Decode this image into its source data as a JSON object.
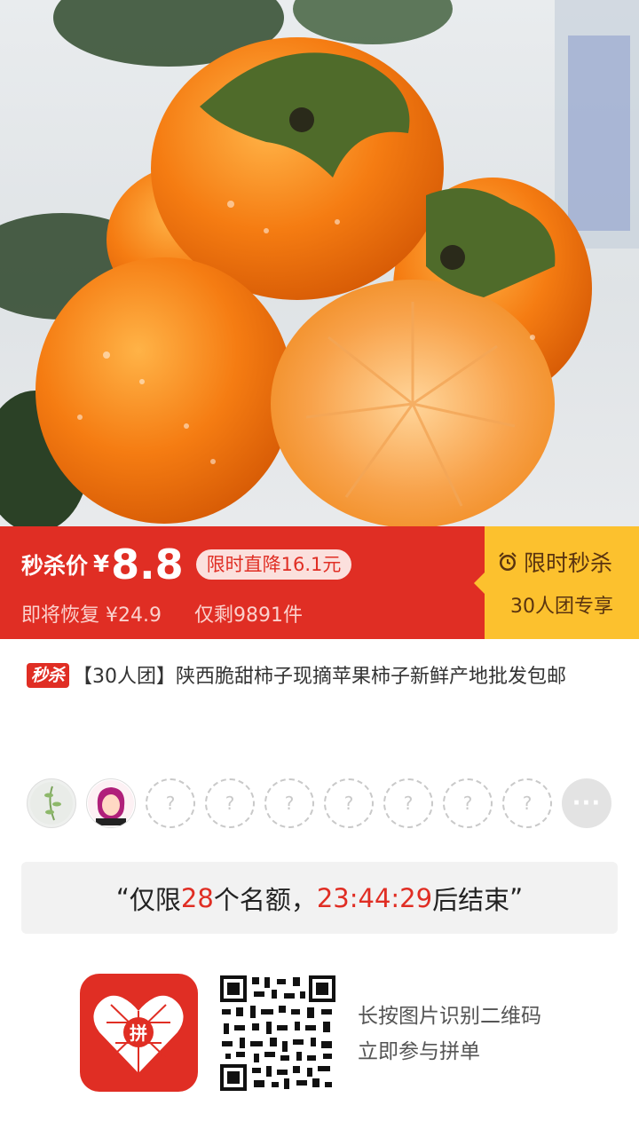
{
  "hero": {
    "image_name": "persimmon-product-photo"
  },
  "banner": {
    "price_label": "秒杀价",
    "currency": "¥",
    "price": "8.8",
    "drop_tag": "限时直降16.1元",
    "restore_text": "即将恢复 ¥24.9",
    "stock_text": "仅剩9891件",
    "flash_title": "限时秒杀",
    "flash_sub": "30人团专享",
    "colors": {
      "red": "#e02e24",
      "yellow": "#fcc12e"
    }
  },
  "product": {
    "badge": "秒杀",
    "title": "【30人团】陕西脆甜柿子现摘苹果柿子新鲜产地批发包邮"
  },
  "group": {
    "empty_slot_glyph": "?",
    "more_glyph": "···",
    "member_count_shown": 2,
    "empty_slots": 7
  },
  "countdown": {
    "open_quote": "“",
    "prefix": "仅限",
    "quota": "28",
    "middle": "个名额，",
    "time": "23:44:29",
    "suffix": "后结束",
    "close_quote": "”"
  },
  "footer": {
    "app_icon": "pinduoduo-app-icon",
    "logo_char": "拼",
    "qr_name": "qr-code",
    "line1": "长按图片识别二维码",
    "line2": "立即参与拼单"
  }
}
